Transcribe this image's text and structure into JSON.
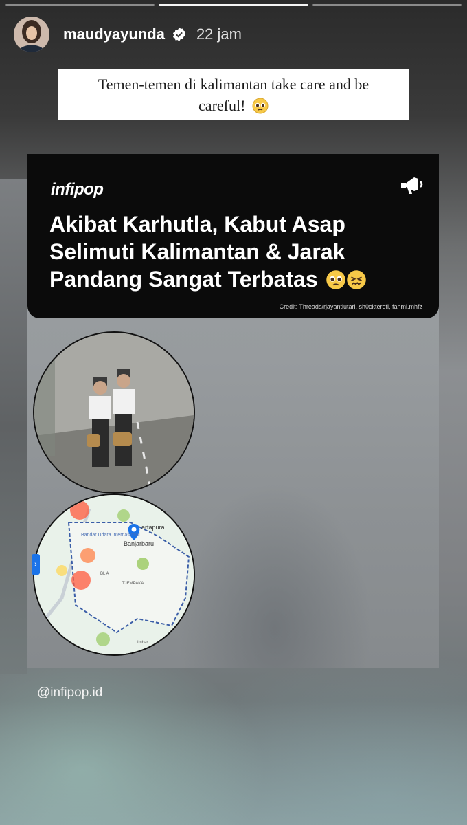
{
  "story": {
    "progress_segments": 3,
    "active_segment": 1,
    "username": "maudyayunda",
    "time_ago": "22 jam",
    "caption_lines": [
      "Temen-temen di kalimantan take care and be",
      "careful!"
    ],
    "caption_emoji": "pleading-face-emoji",
    "mention_tag": "@infipop.id"
  },
  "post": {
    "brand": "infipop",
    "headline": "Akibat Karhutla, Kabut Asap Selimuti Kalimantan & Jarak Pandang Sangat Terbatas",
    "headline_emojis": [
      "pleading-face-emoji",
      "confounded-face-emoji"
    ],
    "credit": "Credit: Threads/rjayantiutari, sh0ckterofi, fahmi.mhfz",
    "map_labels": {
      "city1": "artapura",
      "city2": "Banjarbaru",
      "airport": "Bandar Udara Internasional...",
      "area1": "BL A",
      "area2": "TJEMPAKA",
      "corner": "Imbar"
    },
    "side_tab_label": "›"
  },
  "colors": {
    "banner": "#0b0b0b",
    "caption_bg": "#ffffff",
    "map_pin": "#1a73e8",
    "heat_hot": "#ff5a3c",
    "heat_mild": "#8bc34a"
  }
}
